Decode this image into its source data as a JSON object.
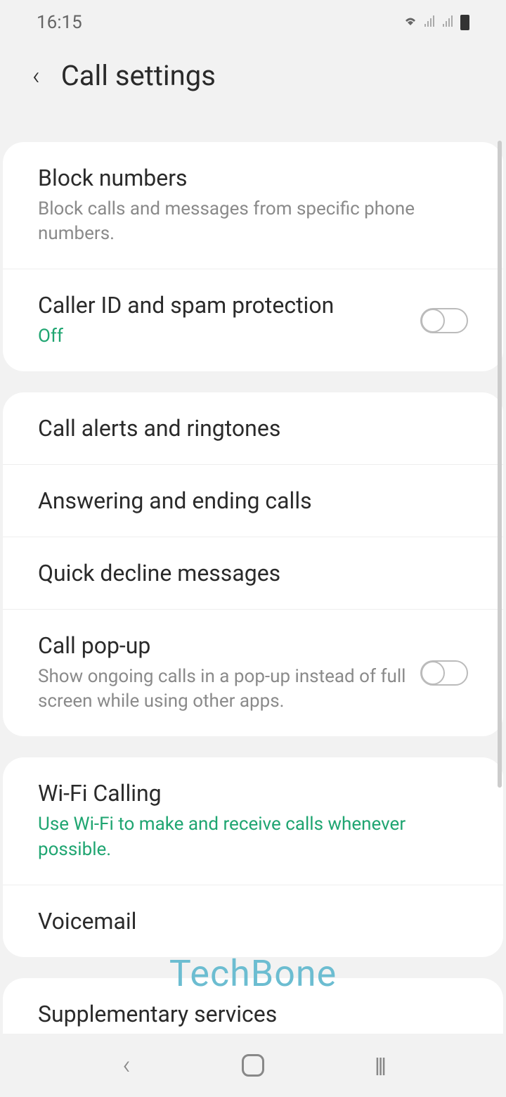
{
  "status": {
    "time": "16:15"
  },
  "header": {
    "title": "Call settings"
  },
  "sections": [
    {
      "items": [
        {
          "title": "Block numbers",
          "subtitle": "Block calls and messages from specific phone numbers."
        },
        {
          "title": "Caller ID and spam protection",
          "status": "Off",
          "toggle": false
        }
      ]
    },
    {
      "items": [
        {
          "title": "Call alerts and ringtones"
        },
        {
          "title": "Answering and ending calls"
        },
        {
          "title": "Quick decline messages"
        },
        {
          "title": "Call pop-up",
          "subtitle": "Show ongoing calls in a pop-up instead of full screen while using other apps.",
          "toggle": false
        }
      ]
    },
    {
      "items": [
        {
          "title": "Wi-Fi Calling",
          "status_green": "Use Wi-Fi to make and receive calls whenever possible."
        },
        {
          "title": "Voicemail"
        }
      ]
    }
  ],
  "cutoff": {
    "title": "Supplementary services"
  },
  "watermark": "TechBone"
}
